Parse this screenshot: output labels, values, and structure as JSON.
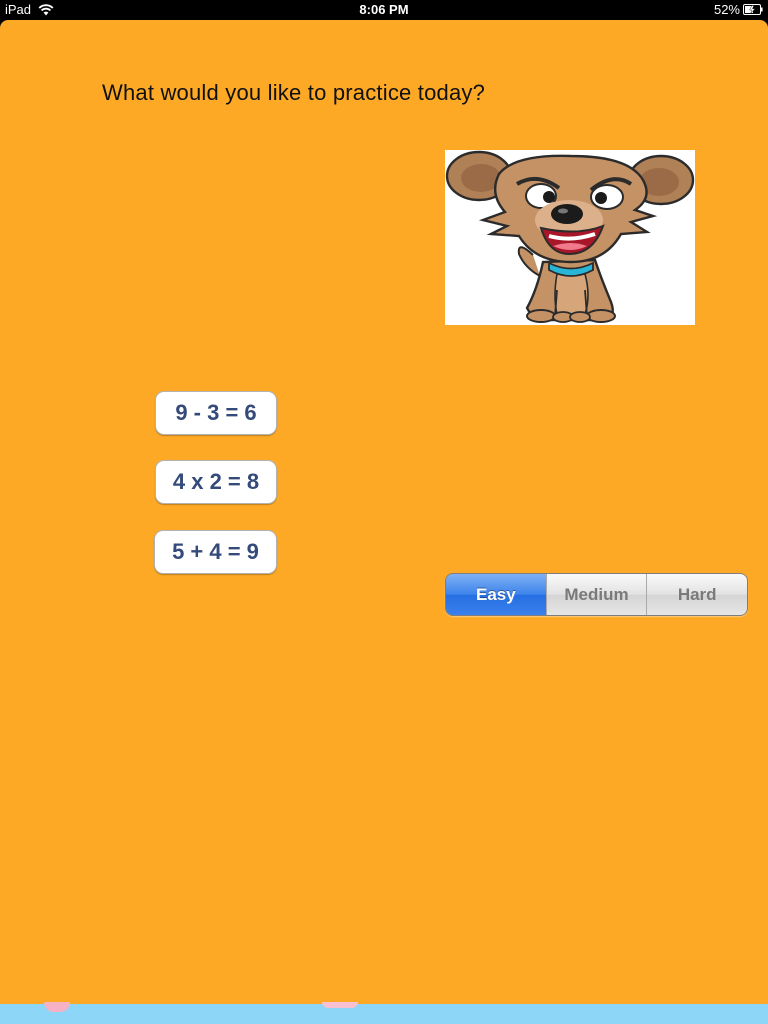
{
  "status_bar": {
    "device": "iPad",
    "time": "8:06 PM",
    "battery": "52%"
  },
  "prompt": "What would you like to practice today?",
  "mascot": {
    "icon": "cartoon-dog-image"
  },
  "operations": [
    {
      "label": "9 - 3 = 6"
    },
    {
      "label": "4 x 2 = 8"
    },
    {
      "label": "5 + 4 = 9"
    }
  ],
  "difficulty": {
    "options": [
      "Easy",
      "Medium",
      "Hard"
    ],
    "selected": "Easy"
  },
  "colors": {
    "background": "#FEA926",
    "button_text": "#344A7B",
    "segment_selected": "#2F78E8",
    "bottom_strip": "#8ED6F7"
  }
}
